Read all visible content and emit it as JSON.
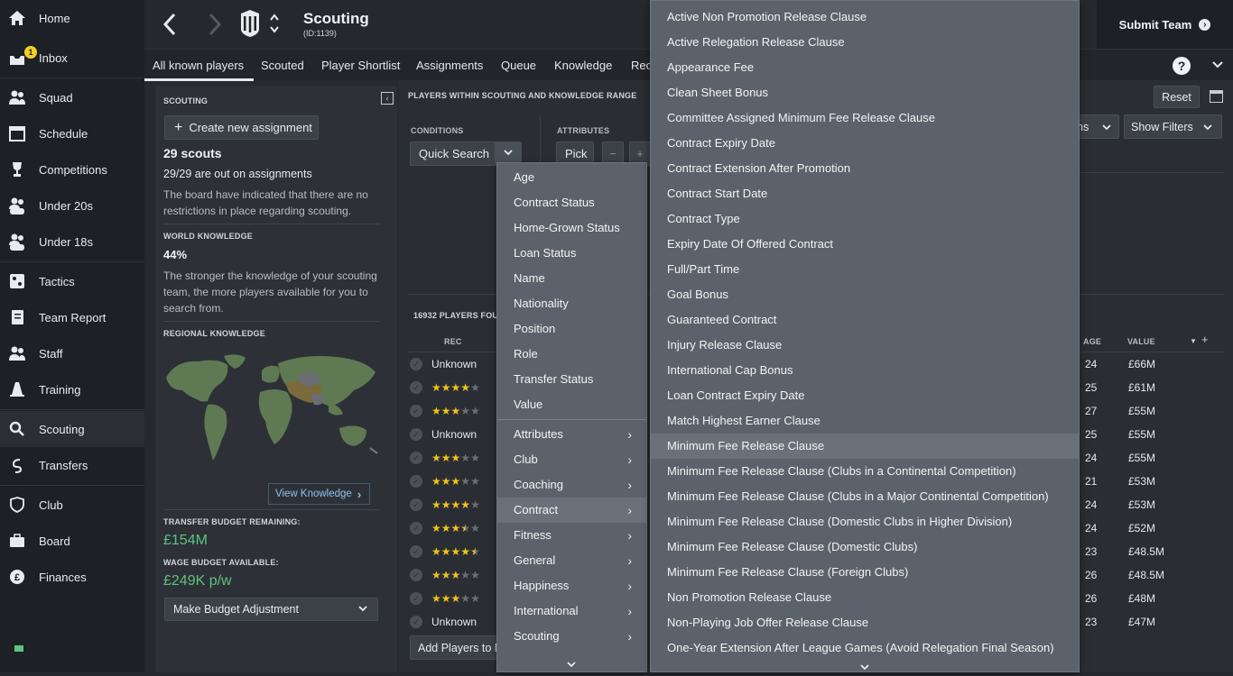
{
  "sidebar": {
    "items": [
      {
        "label": "Home"
      },
      {
        "label": "Inbox",
        "badge": "1"
      },
      {
        "label": "Squad"
      },
      {
        "label": "Schedule"
      },
      {
        "label": "Competitions"
      },
      {
        "label": "Under 20s"
      },
      {
        "label": "Under 18s"
      },
      {
        "label": "Tactics"
      },
      {
        "label": "Team Report"
      },
      {
        "label": "Staff"
      },
      {
        "label": "Training"
      },
      {
        "label": "Scouting"
      },
      {
        "label": "Transfers"
      },
      {
        "label": "Club"
      },
      {
        "label": "Board"
      },
      {
        "label": "Finances"
      }
    ]
  },
  "header": {
    "title": "Scouting",
    "subtitle": "(ID:1139)",
    "submit_label": "Submit Team"
  },
  "tabs": [
    "All known players",
    "Scouted",
    "Player Shortlist",
    "Assignments",
    "Queue",
    "Knowledge",
    "Rec"
  ],
  "left_panel": {
    "section_title": "SCOUTING",
    "create_button": "Create new assignment",
    "scouts": "29 scouts",
    "assignments": "29/29 are out on assignments",
    "board_note": "The board have indicated that there are no restrictions in place regarding scouting.",
    "world_title": "WORLD KNOWLEDGE",
    "world_value": "44%",
    "world_note": "The stronger the knowledge of your scouting team, the more players available for you to search from.",
    "regional_title": "REGIONAL KNOWLEDGE",
    "view_knowledge": "View Knowledge",
    "transfer_title": "TRANSFER BUDGET REMAINING:",
    "transfer_value": "£154M",
    "wage_title": "WAGE BUDGET AVAILABLE:",
    "wage_value": "£249K p/w",
    "budget_button": "Make Budget Adjustment"
  },
  "main": {
    "range_title": "PLAYERS WITHIN SCOUTING AND KNOWLEDGE RANGE",
    "conditions_label": "CONDITIONS",
    "attributes_label": "ATTRIBUTES",
    "quick_search": "Quick Search",
    "pick": "Pick",
    "reset": "Reset",
    "show_filters": "Show Filters",
    "partial_select": "ns",
    "found": "16932 PLAYERS FOU",
    "col_rec": "REC",
    "col_age": "AGE",
    "col_value": "VALUE",
    "add_players": "Add Players to N",
    "rows": [
      {
        "rec": "Unknown",
        "stars": 0,
        "age": "24",
        "value": "£66M"
      },
      {
        "rec": "",
        "stars": 4,
        "age": "25",
        "value": "£61M"
      },
      {
        "rec": "",
        "stars": 3,
        "age": "27",
        "value": "£55M"
      },
      {
        "rec": "Unknown",
        "stars": 0,
        "age": "25",
        "value": "£55M"
      },
      {
        "rec": "",
        "stars": 3,
        "age": "24",
        "value": "£55M"
      },
      {
        "rec": "",
        "stars": 3,
        "age": "21",
        "value": "£53M"
      },
      {
        "rec": "",
        "stars": 4,
        "age": "24",
        "value": "£53M"
      },
      {
        "rec": "",
        "stars": 3.5,
        "age": "24",
        "value": "£52M"
      },
      {
        "rec": "",
        "stars": 4.5,
        "age": "23",
        "value": "£48.5M"
      },
      {
        "rec": "",
        "stars": 3,
        "age": "26",
        "value": "£48.5M"
      },
      {
        "rec": "",
        "stars": 3,
        "age": "26",
        "value": "£48M"
      },
      {
        "rec": "Unknown",
        "stars": 0,
        "age": "23",
        "value": "£47M"
      }
    ]
  },
  "menu1": {
    "items": [
      "Age",
      "Contract Status",
      "Home-Grown Status",
      "Loan Status",
      "Name",
      "Nationality",
      "Position",
      "Role",
      "Transfer Status",
      "Value"
    ],
    "submenus": [
      "Attributes",
      "Club",
      "Coaching",
      "Contract",
      "Fitness",
      "General",
      "Happiness",
      "International",
      "Scouting"
    ],
    "selected": "Contract"
  },
  "menu2": {
    "items": [
      "Active Non Promotion Release Clause",
      "Active Relegation Release Clause",
      "Appearance Fee",
      "Clean Sheet Bonus",
      "Committee Assigned Minimum Fee Release Clause",
      "Contract Expiry Date",
      "Contract Extension After Promotion",
      "Contract Start Date",
      "Contract Type",
      "Expiry Date Of Offered Contract",
      "Full/Part Time",
      "Goal Bonus",
      "Guaranteed Contract",
      "Injury Release Clause",
      "International Cap Bonus",
      "Loan Contract Expiry Date",
      "Match Highest Earner Clause",
      "Minimum Fee Release Clause",
      "Minimum Fee Release Clause (Clubs in a Continental Competition)",
      "Minimum Fee Release Clause (Clubs in a Major Continental Competition)",
      "Minimum Fee Release Clause (Domestic Clubs in Higher Division)",
      "Minimum Fee Release Clause (Domestic Clubs)",
      "Minimum Fee Release Clause (Foreign Clubs)",
      "Non Promotion Release Clause",
      "Non-Playing Job Offer Release Clause",
      "One-Year Extension After League Games (Avoid Relegation Final Season)"
    ],
    "selected": "Minimum Fee Release Clause"
  },
  "colors": {
    "accent_green": "#5fc27e",
    "star": "#f2c21b",
    "badge": "#f2cf28"
  }
}
